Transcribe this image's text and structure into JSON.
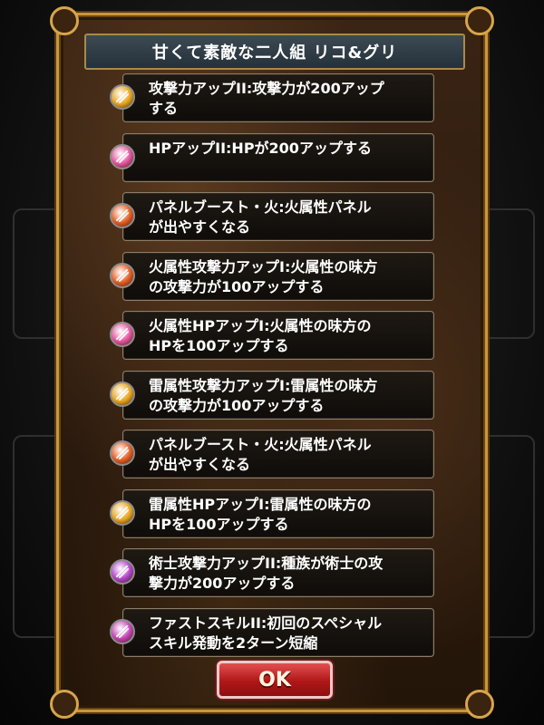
{
  "dialog": {
    "title": "甘くて素敵な二人組 リコ&グリ",
    "ok_label": "OK"
  },
  "skills": [
    {
      "text": "攻撃力アップII:攻撃力が200アップ\nする",
      "icon": "attack-up-icon",
      "color": "#e3a21a"
    },
    {
      "text": "HPアップII:HPが200アップする",
      "icon": "hp-up-icon",
      "color": "#e0509a"
    },
    {
      "text": "パネルブースト・火:火属性パネル\nが出やすくなる",
      "icon": "fire-panel-icon",
      "color": "#e05a20"
    },
    {
      "text": "火属性攻撃力アップI:火属性の味方\nの攻撃力が100アップする",
      "icon": "fire-attack-up-icon",
      "color": "#e05a20"
    },
    {
      "text": "火属性HPアップI:火属性の味方の\nHPを100アップする",
      "icon": "fire-hp-up-icon",
      "color": "#e0509a"
    },
    {
      "text": "雷属性攻撃力アップI:雷属性の味方\nの攻撃力が100アップする",
      "icon": "thunder-attack-up-icon",
      "color": "#e3a21a"
    },
    {
      "text": "パネルブースト・火:火属性パネル\nが出やすくなる",
      "icon": "fire-panel-icon",
      "color": "#e05a20"
    },
    {
      "text": "雷属性HPアップI:雷属性の味方の\nHPを100アップする",
      "icon": "thunder-hp-up-icon",
      "color": "#e3a21a"
    },
    {
      "text": "術士攻撃力アップII:種族が術士の攻\n撃力が200アップする",
      "icon": "mage-attack-up-icon",
      "color": "#b040c8"
    },
    {
      "text": "ファストスキルII:初回のスペシャル\nスキル発動を2ターン短縮",
      "icon": "fast-skill-icon",
      "color": "#c040b0"
    }
  ]
}
